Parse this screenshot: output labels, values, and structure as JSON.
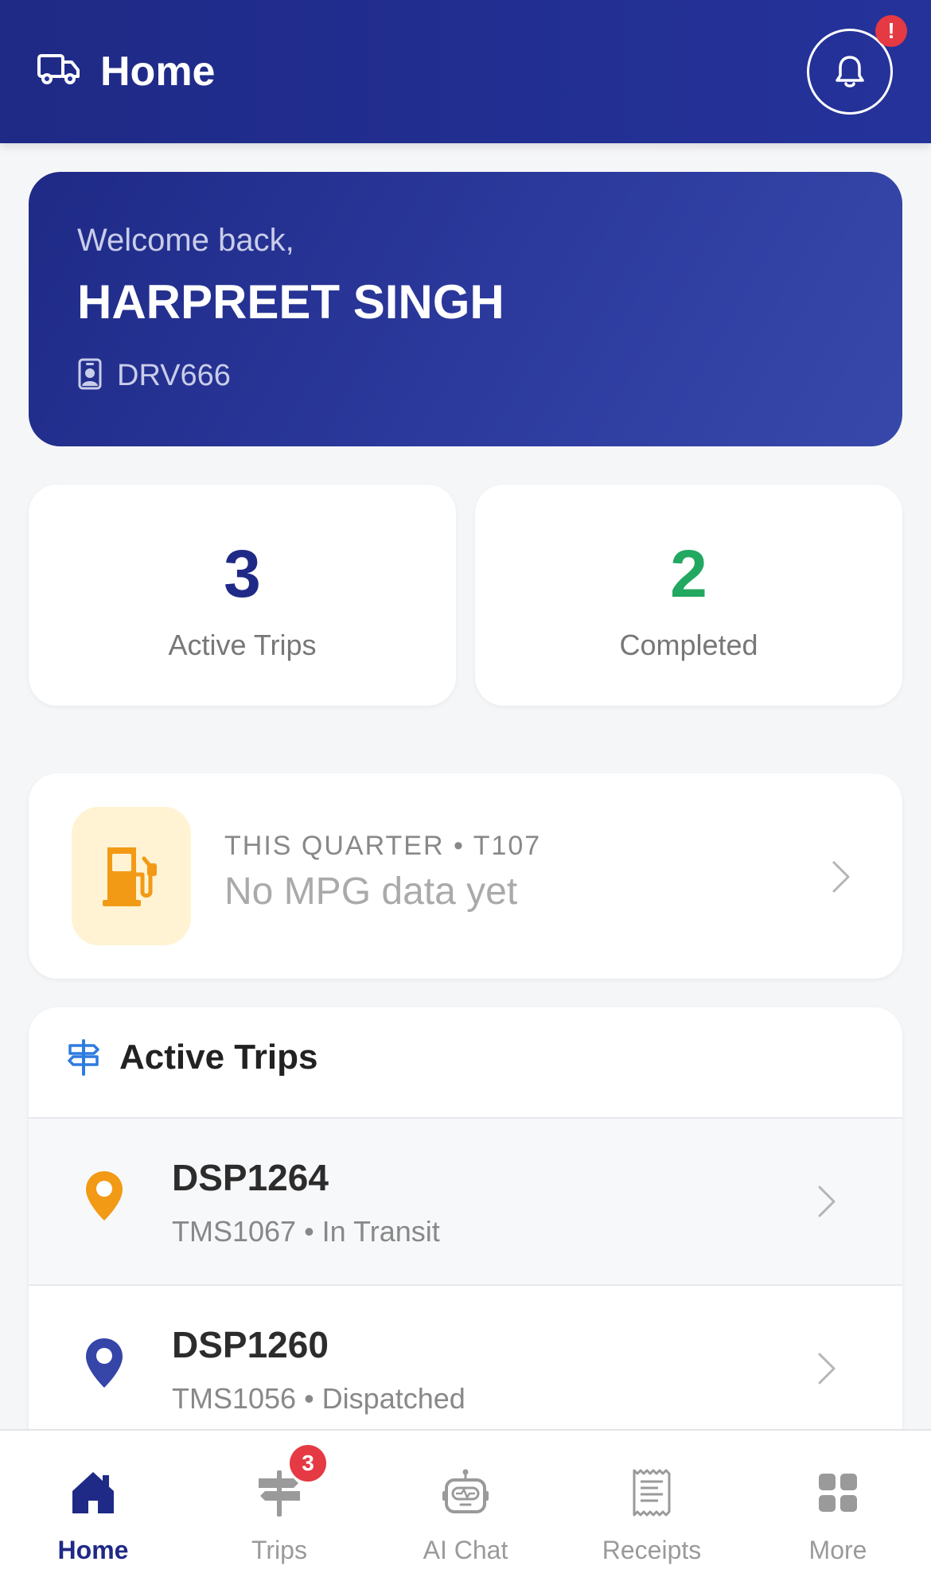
{
  "header": {
    "title": "Home",
    "truck_icon": "truck-icon",
    "bell_icon": "bell-icon",
    "alert_badge": "!"
  },
  "welcome": {
    "greeting": "Welcome back,",
    "driver_name": "HARPREET SINGH",
    "driver_id": "DRV666",
    "badge_icon": "id-badge-icon"
  },
  "stats": {
    "active_trips": {
      "value": "3",
      "label": "Active Trips",
      "color": "#1f2a86"
    },
    "completed": {
      "value": "2",
      "label": "Completed",
      "color": "#22a860"
    }
  },
  "mpg": {
    "period": "THIS QUARTER • T107",
    "value": "No MPG data yet",
    "icon": "fuel-pump-icon",
    "accent": "#f29a16"
  },
  "active_trips": {
    "title": "Active Trips",
    "icon": "signpost-icon",
    "items": [
      {
        "code": "DSP1264",
        "subtitle": "TMS1067 • In Transit",
        "pin_color": "#f29a16"
      },
      {
        "code": "DSP1260",
        "subtitle": "TMS1056 • Dispatched",
        "pin_color": "#3545a8"
      }
    ]
  },
  "bottom_nav": {
    "items": [
      {
        "label": "Home",
        "icon": "home-icon",
        "active": true
      },
      {
        "label": "Trips",
        "icon": "signpost-icon",
        "badge": "3"
      },
      {
        "label": "AI Chat",
        "icon": "robot-icon"
      },
      {
        "label": "Receipts",
        "icon": "receipt-icon"
      },
      {
        "label": "More",
        "icon": "grid-icon"
      }
    ]
  },
  "colors": {
    "primary": "#1f2a86",
    "success": "#22a860",
    "warning": "#f29a16",
    "danger": "#e53943"
  }
}
